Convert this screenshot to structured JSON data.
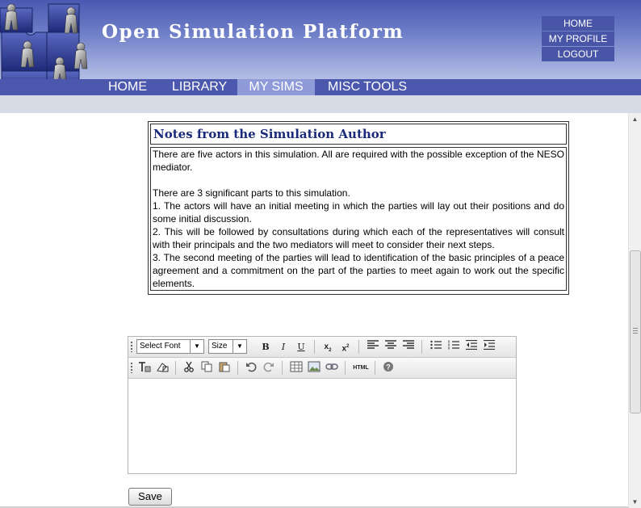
{
  "header": {
    "site_title": "Open Simulation Platform",
    "top_links": [
      "HOME",
      "MY PROFILE",
      "LOGOUT"
    ],
    "tabs": [
      "HOME",
      "LIBRARY",
      "MY SIMS",
      "MISC TOOLS"
    ],
    "active_tab": "MY SIMS"
  },
  "notes": {
    "title": "Notes from the Simulation Author",
    "p1": "There are five actors in this simulation. All are required with the possible exception of the NESO mediator.",
    "p2": "There are 3 significant parts to this simulation.",
    "item1": "1. The actors will have an initial meeting in which the parties will lay out their positions and do some initial discussion.",
    "item2": "2. This will be followed by consultations during which each of the representatives will consult with their principals and the two mediators will meet to consider their next steps.",
    "item3": "3. The second meeting of the parties will lead to identification of the basic principles of a peace agreement and a commitment on the part of the parties to meet again to work out the specific elements."
  },
  "editor": {
    "font_select": "Select Font",
    "size_select": "Size",
    "bold": "B",
    "italic": "I",
    "underline": "U",
    "html_button": "HTML"
  },
  "save_label": "Save",
  "colors": {
    "header_dark": "#4b58ae",
    "active_tab": "#8e9bd8",
    "notes_title": "#1a2a7a"
  }
}
